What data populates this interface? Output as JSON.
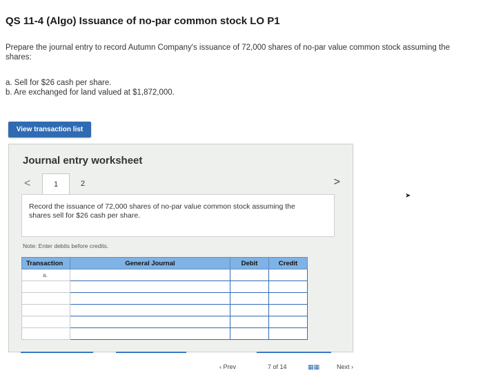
{
  "page": {
    "title": "QS 11-4 (Algo) Issuance of no-par common stock LO P1",
    "prompt": "Prepare the journal entry to record Autumn Company's issuance of 72,000 shares of no-par value common stock assuming the shares:",
    "parts": [
      "a. Sell for $26 cash per share.",
      "b. Are exchanged for land valued at $1,872,000."
    ]
  },
  "view_transaction_button": "View transaction list",
  "worksheet": {
    "heading": "Journal entry worksheet",
    "tabs": [
      "1",
      "2"
    ],
    "prev_icon": "<",
    "next_icon": ">",
    "instruction": "Record the issuance of 72,000 shares of no-par value common stock assuming the shares sell for $26 cash per share.",
    "note": "Note: Enter debits before credits.",
    "table": {
      "headers": [
        "Transaction",
        "General Journal",
        "Debit",
        "Credit"
      ],
      "rows": [
        [
          "a.",
          "",
          "",
          ""
        ],
        [
          "",
          "",
          "",
          ""
        ],
        [
          "",
          "",
          "",
          ""
        ],
        [
          "",
          "",
          "",
          ""
        ],
        [
          "",
          "",
          "",
          ""
        ],
        [
          "",
          "",
          "",
          ""
        ]
      ]
    }
  },
  "footer": {
    "prev_partial": "‹ Prev",
    "page_partial": "7 of 14",
    "grid_icon": "grid-icon",
    "next_partial": "Next ›"
  }
}
